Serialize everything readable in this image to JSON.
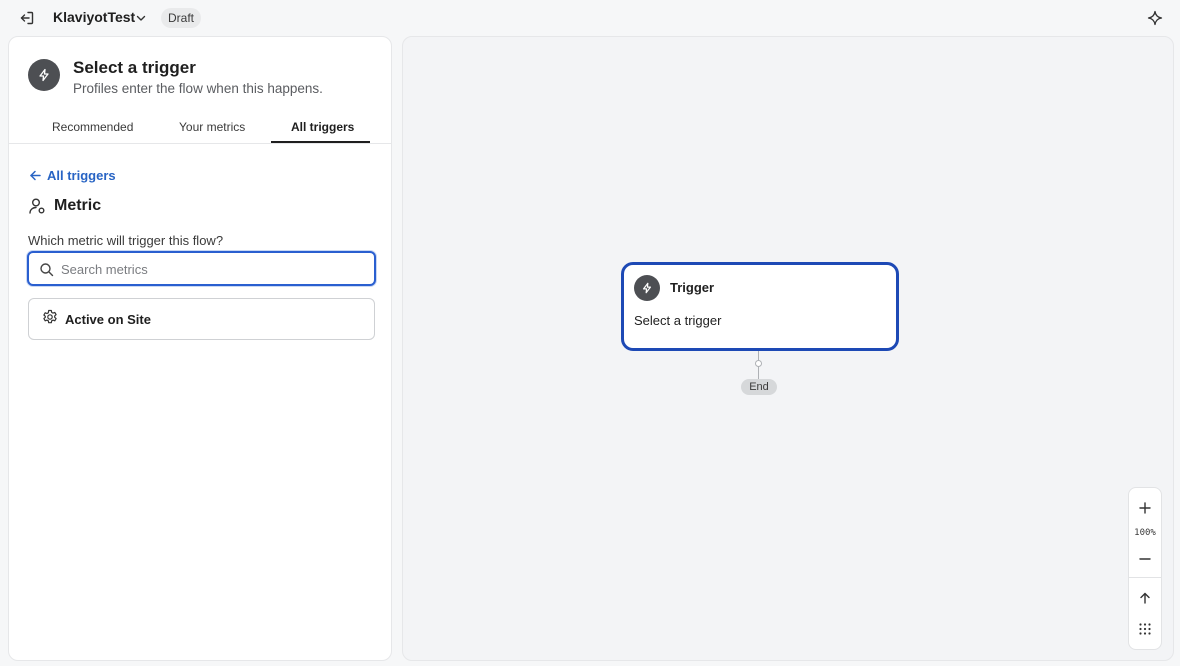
{
  "topbar": {
    "flow_name": "KlaviyotTest",
    "status_badge": "Draft"
  },
  "panel": {
    "title": "Select a trigger",
    "subtitle": "Profiles enter the flow when this happens.",
    "tabs": [
      {
        "label": "Recommended",
        "active": false
      },
      {
        "label": "Your metrics",
        "active": false
      },
      {
        "label": "All triggers",
        "active": true
      }
    ],
    "back_link": "All triggers",
    "section_title": "Metric",
    "question": "Which metric will trigger this flow?",
    "search": {
      "placeholder": "Search metrics",
      "value": ""
    },
    "options": [
      {
        "label": "Active on Site",
        "icon": "gear-icon"
      }
    ]
  },
  "canvas": {
    "node": {
      "title": "Trigger",
      "subtitle": "Select a trigger"
    },
    "end_label": "End",
    "zoom_level": "100%"
  },
  "colors": {
    "accent": "#2864c4",
    "node_border": "#1d49b5",
    "icon_circle": "#4d4f53"
  }
}
